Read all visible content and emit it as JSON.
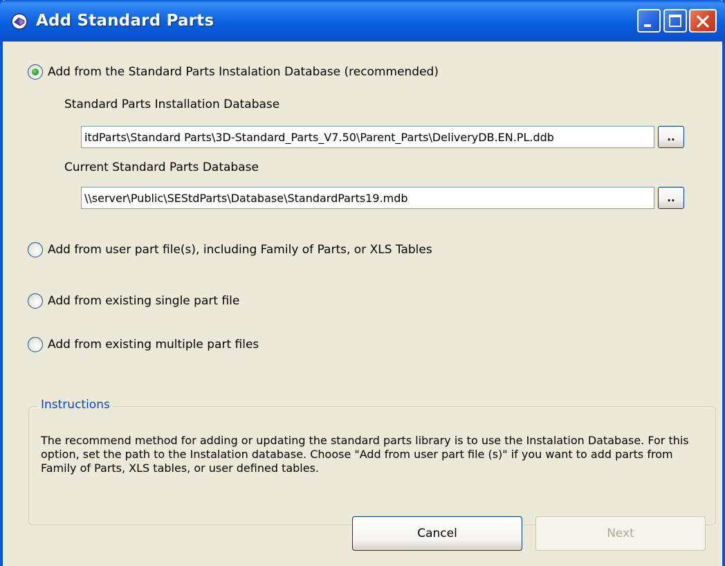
{
  "window": {
    "title": "Add Standard Parts"
  },
  "options": {
    "installation_db": {
      "label": "Add from the Standard Parts Instalation Database (recommended)",
      "checked": true
    },
    "user_part_files": {
      "label": "Add from user part file(s), including Family of Parts, or XLS Tables",
      "checked": false
    },
    "single_part": {
      "label": "Add from existing single part file",
      "checked": false
    },
    "multiple_parts": {
      "label": "Add from existing multiple part files",
      "checked": false
    }
  },
  "install_db": {
    "label": "Standard Parts Installation Database",
    "value": "itdParts\\Standard Parts\\3D-Standard_Parts_V7.50\\Parent_Parts\\DeliveryDB.EN.PL.ddb",
    "browse_label": ".."
  },
  "current_db": {
    "label": "Current Standard Parts Database",
    "value": "\\\\server\\Public\\SEStdParts\\Database\\StandardParts19.mdb",
    "browse_label": ".."
  },
  "instructions": {
    "title": "Instructions",
    "text": "The recommend method for adding or updating the standard parts library is to use the Instalation Database. For this option, set the path to the Instalation database. Choose \"Add from user part file (s)\" if you want to add parts from Family of Parts, XLS tables, or user defined tables."
  },
  "buttons": {
    "cancel": "Cancel",
    "next": "Next"
  },
  "icons": {
    "app": "standard-parts-app-icon",
    "minimize": "minimize-icon",
    "maximize": "maximize-icon",
    "close": "close-icon"
  },
  "colors": {
    "title_bar": "#0a5bd8",
    "close_button": "#d4452a",
    "group_legend": "#0046d5",
    "window_bg": "#ece9d8"
  }
}
